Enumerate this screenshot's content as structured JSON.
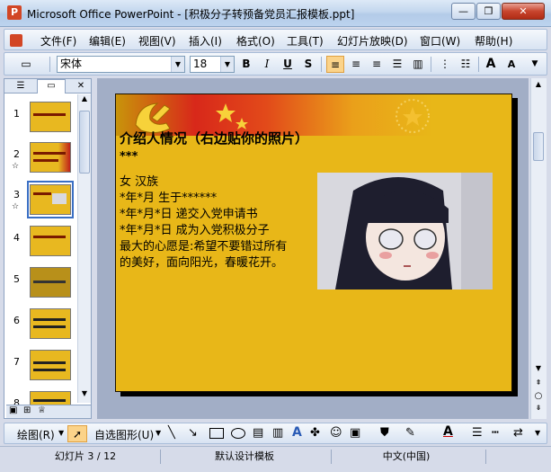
{
  "window": {
    "title": "Microsoft Office PowerPoint - [积极分子转预备党员汇报模板.ppt]",
    "app_icon": "powerpoint-icon"
  },
  "menu": [
    "文件(F)",
    "编辑(E)",
    "视图(V)",
    "插入(I)",
    "格式(O)",
    "工具(T)",
    "幻灯片放映(D)",
    "窗口(W)",
    "帮助(H)"
  ],
  "toolbar": {
    "font_name": "宋体",
    "font_size": "18",
    "bold": "B",
    "italic": "I",
    "underline": "U",
    "shadow": "S",
    "grow_font": "A",
    "shrink_font": "A"
  },
  "panel_tabs": [
    "outline-tab-icon",
    "slides-tab-icon"
  ],
  "close_glyph": "✕",
  "thumbnails": [
    "1",
    "2",
    "3",
    "4",
    "5",
    "6",
    "7",
    "8"
  ],
  "slide": {
    "title": "介绍人情况（右边贴你的照片）",
    "subtitle": "***",
    "body": [
      "女  汉族",
      "*年*月 生于******",
      "*年*月*日  递交入党申请书",
      "*年*月*日  成为入党积极分子",
      "最大的心愿是:希望不要错过所有",
      "的美好，面向阳光，春暖花开。"
    ]
  },
  "drawbar": {
    "draw_label": "绘图(R)",
    "autoshapes_label": "自选图形(U)"
  },
  "status": {
    "slide_info": "幻灯片 3 / 12",
    "template": "默认设计模板",
    "language": "中文(中国)"
  },
  "colors": {
    "slide_background": "#e8b718",
    "selected_thumb_border": "#3a6fc4"
  }
}
